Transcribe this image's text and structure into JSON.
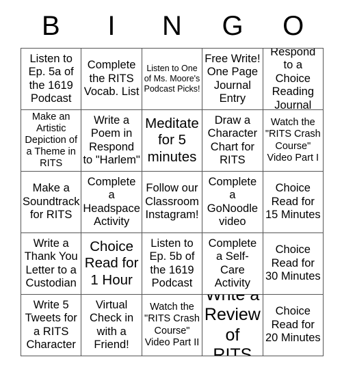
{
  "header": {
    "letters": [
      "B",
      "I",
      "N",
      "G",
      "O"
    ]
  },
  "grid": {
    "rows": 5,
    "columns": 5,
    "border_color": "#555555",
    "background_color": "#ffffff",
    "text_color": "#000000",
    "cells": [
      {
        "text": "Listen to Ep. 5a of the 1619 Podcast",
        "size": "md"
      },
      {
        "text": "Complete the RITS Vocab. List",
        "size": "md"
      },
      {
        "text": "Listen to One of Ms. Moore's Podcast Picks!",
        "size": "xs"
      },
      {
        "text": "Free Write! One Page Journal Entry",
        "size": "md"
      },
      {
        "text": "Respond to a Choice Reading Journal",
        "size": "md"
      },
      {
        "text": "Make an Artistic Depiction of a Theme in RITS",
        "size": "sm"
      },
      {
        "text": "Write a Poem in Respond to \"Harlem\"",
        "size": "md"
      },
      {
        "text": "Meditate for 5 minutes",
        "size": "lg"
      },
      {
        "text": "Draw a Character Chart for RITS",
        "size": "md"
      },
      {
        "text": "Watch the \"RITS Crash Course\" Video Part I",
        "size": "sm"
      },
      {
        "text": "Make a Soundtrack for RITS",
        "size": "md"
      },
      {
        "text": "Complete a Headspace Activity",
        "size": "md"
      },
      {
        "text": "Follow our Classroom Instagram!",
        "size": "md"
      },
      {
        "text": "Complete a GoNoodle video",
        "size": "md"
      },
      {
        "text": "Choice Read for 15 Minutes",
        "size": "md"
      },
      {
        "text": "Write a Thank You Letter to a Custodian",
        "size": "md"
      },
      {
        "text": "Choice Read for 1 Hour",
        "size": "lg"
      },
      {
        "text": "Listen to Ep. 5b of the 1619 Podcast",
        "size": "md"
      },
      {
        "text": "Complete a Self-Care Activity",
        "size": "md"
      },
      {
        "text": "Choice Read for 30 Minutes",
        "size": "md"
      },
      {
        "text": "Write 5 Tweets for a RITS Character",
        "size": "md"
      },
      {
        "text": "Virtual Check in with a Friend!",
        "size": "md"
      },
      {
        "text": "Watch the \"RITS Crash Course\" Video Part II",
        "size": "sm"
      },
      {
        "text": "Write a Review of RITS",
        "size": "xl"
      },
      {
        "text": "Choice Read for 20 Minutes",
        "size": "md"
      }
    ]
  }
}
